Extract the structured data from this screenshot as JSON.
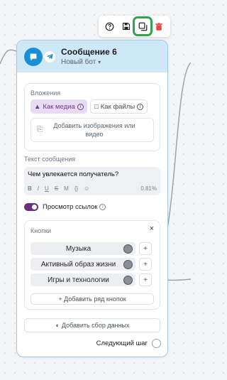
{
  "toolbar": {
    "items": [
      {
        "icon": "help-circle-icon"
      },
      {
        "icon": "save-icon"
      },
      {
        "icon": "duplicate-icon",
        "active": true
      },
      {
        "icon": "trash-icon",
        "color": "#e54848"
      }
    ]
  },
  "node": {
    "title": "Сообщение 6",
    "bot": "Новый бот",
    "attachments": {
      "label": "Вложения",
      "as_media": "Как медиа",
      "as_files": "Как файлы",
      "add_media": "Добавить изображения или видео"
    },
    "message": {
      "label": "Текст сообщения",
      "text": "Чем увлекается получатель?",
      "format_buttons": [
        "B",
        "I",
        "U",
        "S",
        "M",
        "{}",
        "☺"
      ],
      "percent": "0.81%"
    },
    "link_preview": {
      "label": "Просмотр ссылок",
      "enabled": true
    },
    "buttons": {
      "label": "Кнопки",
      "items": [
        {
          "label": "Музыка"
        },
        {
          "label": "Активный образ жизни"
        },
        {
          "label": "Игры и технологии"
        }
      ],
      "add_row": "+ Добавить ряд кнопок"
    },
    "add_data": "Добавить сбор данных",
    "next_step": "Следующий шаг"
  },
  "colors": {
    "header": "#cfe8f7",
    "accent": "#6b2f7e",
    "telegram": "#1b8fd6",
    "highlight": "#2ea44f"
  }
}
